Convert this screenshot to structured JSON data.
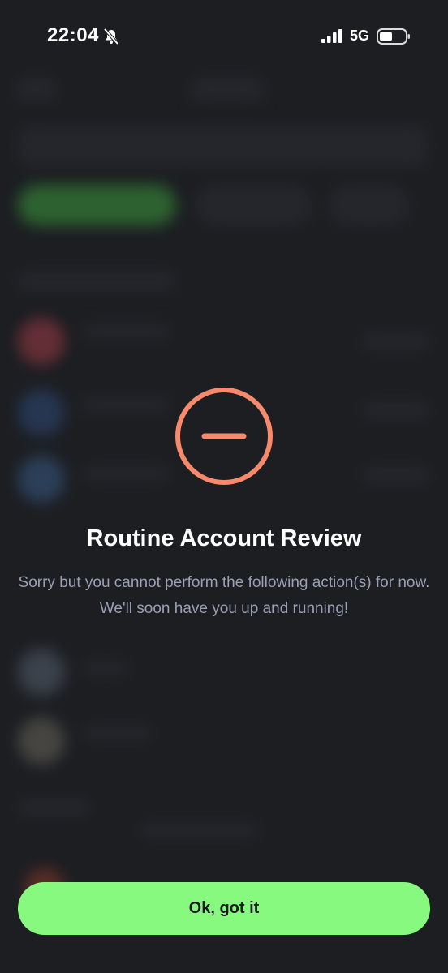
{
  "status_bar": {
    "time": "22:04",
    "network": "5G",
    "icons": [
      "bell-muted-icon",
      "signal-icon",
      "battery-icon"
    ]
  },
  "dialog": {
    "icon": "minus-circle-icon",
    "title": "Routine Account Review",
    "message": "Sorry but you cannot perform the following action(s) for now. We'll soon have you up and running!",
    "button_label": "Ok, got it"
  },
  "colors": {
    "accent_green": "#87f97f",
    "alert_orange": "#f7896d",
    "background": "#1c1e22",
    "message_text": "#9aa0b4"
  }
}
